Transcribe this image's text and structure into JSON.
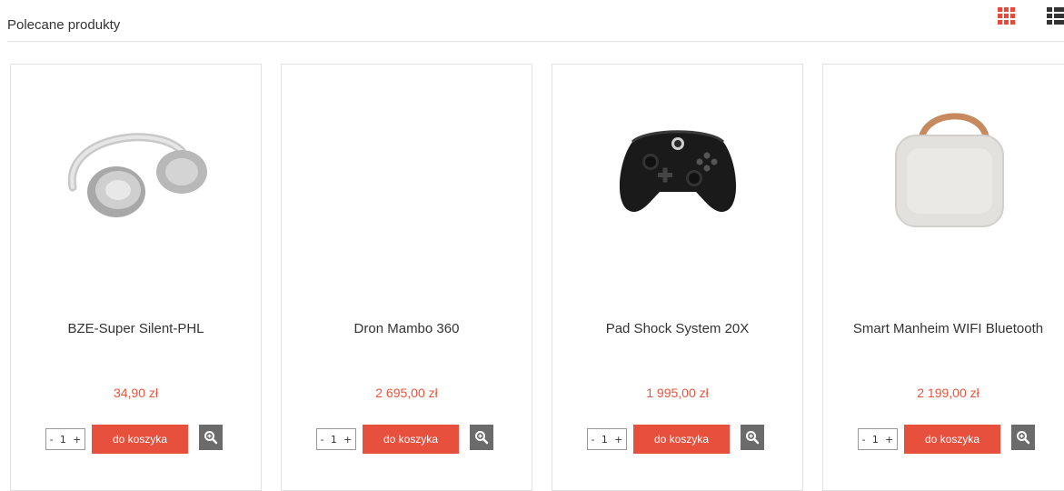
{
  "header": {
    "title": "Polecane produkty",
    "grid_view_icon": "grid-view-icon",
    "list_view_icon": "list-view-icon",
    "accent_color": "#e84a3a"
  },
  "products": [
    {
      "name": "BZE-Super Silent-PHL",
      "price": "34,90 zł",
      "qty_minus": "-",
      "qty_value": "1",
      "qty_plus": "+",
      "cart_label": "do koszyka",
      "image": "headphones"
    },
    {
      "name": "Dron Mambo 360",
      "price": "2 695,00 zł",
      "qty_minus": "-",
      "qty_value": "1",
      "qty_plus": "+",
      "cart_label": "do koszyka",
      "image": "none"
    },
    {
      "name": "Pad Shock System 20X",
      "price": "1 995,00 zł",
      "qty_minus": "-",
      "qty_value": "1",
      "qty_plus": "+",
      "cart_label": "do koszyka",
      "image": "gamepad"
    },
    {
      "name": "Smart Manheim WIFI Bluetooth",
      "price": "2 199,00 zł",
      "qty_minus": "-",
      "qty_value": "1",
      "qty_plus": "+",
      "cart_label": "do koszyka",
      "image": "speaker"
    }
  ],
  "colors": {
    "price": "#e8553f",
    "button": "#e8503e",
    "zoom": "#6b6b6b"
  }
}
